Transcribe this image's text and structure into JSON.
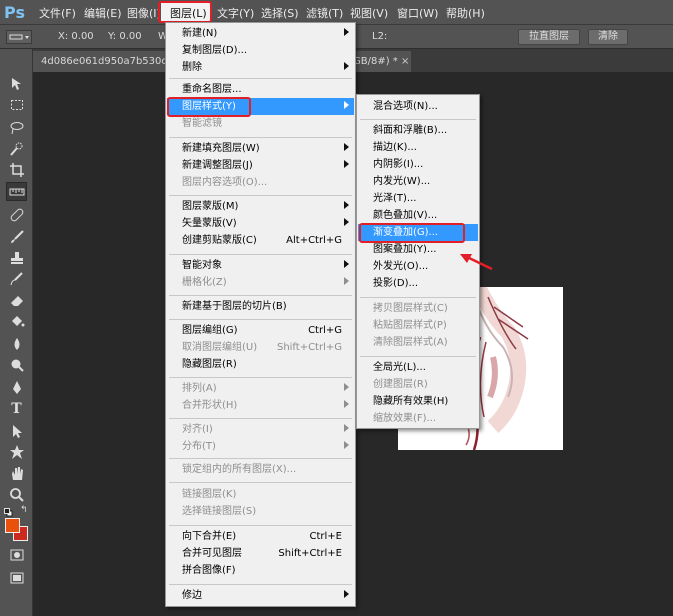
{
  "app": {
    "logo": "Ps"
  },
  "menubar": {
    "items": [
      "文件(F)",
      "编辑(E)",
      "图像(I)",
      "图层(L)",
      "文字(Y)",
      "选择(S)",
      "滤镜(T)",
      "视图(V)",
      "窗口(W)",
      "帮助(H)"
    ]
  },
  "options": {
    "x_label": "X: 0.00",
    "y_label": "Y: 0.00",
    "w_label": "W",
    "l2_label": "L2:",
    "straighten_button": "拉直图层",
    "clear_button": "清除"
  },
  "tabs": [
    {
      "label": "4d086e061d950a7b530cb7"
    },
    {
      "label": "GB/8#) *"
    }
  ],
  "tab_close_glyph": "×",
  "layer_menu": {
    "items": [
      {
        "label": "新建(N)",
        "shortcut": "",
        "submenu": true,
        "disabled": false
      },
      {
        "label": "复制图层(D)...",
        "shortcut": "",
        "submenu": false,
        "disabled": false
      },
      {
        "label": "删除",
        "shortcut": "",
        "submenu": true,
        "disabled": false
      },
      {
        "label": "重命名图层...",
        "shortcut": "",
        "submenu": false,
        "disabled": false
      },
      {
        "label": "图层样式(Y)",
        "shortcut": "",
        "submenu": true,
        "disabled": false,
        "highlighted": true
      },
      {
        "label": "智能滤镜",
        "shortcut": "",
        "submenu": false,
        "disabled": true
      },
      {
        "label": "新建填充图层(W)",
        "shortcut": "",
        "submenu": true,
        "disabled": false
      },
      {
        "label": "新建调整图层(J)",
        "shortcut": "",
        "submenu": true,
        "disabled": false
      },
      {
        "label": "图层内容选项(O)...",
        "shortcut": "",
        "submenu": false,
        "disabled": true
      },
      {
        "label": "图层蒙版(M)",
        "shortcut": "",
        "submenu": true,
        "disabled": false
      },
      {
        "label": "矢量蒙版(V)",
        "shortcut": "",
        "submenu": true,
        "disabled": false
      },
      {
        "label": "创建剪贴蒙版(C)",
        "shortcut": "Alt+Ctrl+G",
        "submenu": false,
        "disabled": false
      },
      {
        "label": "智能对象",
        "shortcut": "",
        "submenu": true,
        "disabled": false
      },
      {
        "label": "栅格化(Z)",
        "shortcut": "",
        "submenu": true,
        "disabled": true
      },
      {
        "label": "新建基于图层的切片(B)",
        "shortcut": "",
        "submenu": false,
        "disabled": false
      },
      {
        "label": "图层编组(G)",
        "shortcut": "Ctrl+G",
        "submenu": false,
        "disabled": false
      },
      {
        "label": "取消图层编组(U)",
        "shortcut": "Shift+Ctrl+G",
        "submenu": false,
        "disabled": true
      },
      {
        "label": "隐藏图层(R)",
        "shortcut": "",
        "submenu": false,
        "disabled": false
      },
      {
        "label": "排列(A)",
        "shortcut": "",
        "submenu": true,
        "disabled": true
      },
      {
        "label": "合并形状(H)",
        "shortcut": "",
        "submenu": true,
        "disabled": true
      },
      {
        "label": "对齐(I)",
        "shortcut": "",
        "submenu": true,
        "disabled": true
      },
      {
        "label": "分布(T)",
        "shortcut": "",
        "submenu": true,
        "disabled": true
      },
      {
        "label": "锁定组内的所有图层(X)...",
        "shortcut": "",
        "submenu": false,
        "disabled": true
      },
      {
        "label": "链接图层(K)",
        "shortcut": "",
        "submenu": false,
        "disabled": true
      },
      {
        "label": "选择链接图层(S)",
        "shortcut": "",
        "submenu": false,
        "disabled": true
      },
      {
        "label": "向下合并(E)",
        "shortcut": "Ctrl+E",
        "submenu": false,
        "disabled": false
      },
      {
        "label": "合并可见图层",
        "shortcut": "Shift+Ctrl+E",
        "submenu": false,
        "disabled": false
      },
      {
        "label": "拼合图像(F)",
        "shortcut": "",
        "submenu": false,
        "disabled": false
      },
      {
        "label": "修边",
        "shortcut": "",
        "submenu": true,
        "disabled": false
      }
    ]
  },
  "style_submenu": {
    "items": [
      {
        "label": "混合选项(N)...",
        "disabled": false
      },
      {
        "label": "斜面和浮雕(B)...",
        "disabled": false
      },
      {
        "label": "描边(K)...",
        "disabled": false
      },
      {
        "label": "内阴影(I)...",
        "disabled": false
      },
      {
        "label": "内发光(W)...",
        "disabled": false
      },
      {
        "label": "光泽(T)...",
        "disabled": false
      },
      {
        "label": "颜色叠加(V)...",
        "disabled": false
      },
      {
        "label": "渐变叠加(G)...",
        "disabled": false,
        "highlighted": true
      },
      {
        "label": "图案叠加(Y)...",
        "disabled": false
      },
      {
        "label": "外发光(O)...",
        "disabled": false
      },
      {
        "label": "投影(D)...",
        "disabled": false
      },
      {
        "label": "拷贝图层样式(C)",
        "disabled": true
      },
      {
        "label": "粘贴图层样式(P)",
        "disabled": true
      },
      {
        "label": "清除图层样式(A)",
        "disabled": true
      },
      {
        "label": "全局光(L)...",
        "disabled": false
      },
      {
        "label": "创建图层(R)",
        "disabled": true
      },
      {
        "label": "隐藏所有效果(H)",
        "disabled": false
      },
      {
        "label": "缩放效果(F)...",
        "disabled": true
      }
    ]
  },
  "tools": [
    "move-tool-icon",
    "marquee-tool-icon",
    "lasso-tool-icon",
    "quick-select-tool-icon",
    "crop-tool-icon",
    "ruler-tool-icon",
    "healing-brush-icon",
    "brush-tool-icon",
    "clone-stamp-icon",
    "history-brush-icon",
    "eraser-tool-icon",
    "paint-bucket-icon",
    "blur-tool-icon",
    "dodge-tool-icon",
    "pen-tool-icon",
    "type-tool-icon",
    "path-select-icon",
    "shape-tool-icon",
    "hand-tool-icon",
    "zoom-tool-icon"
  ],
  "colors": {
    "foreground": "#e8520c",
    "background": "#cc2a1e",
    "highlight": "#3399ff",
    "annotation_red": "#e21e26"
  }
}
